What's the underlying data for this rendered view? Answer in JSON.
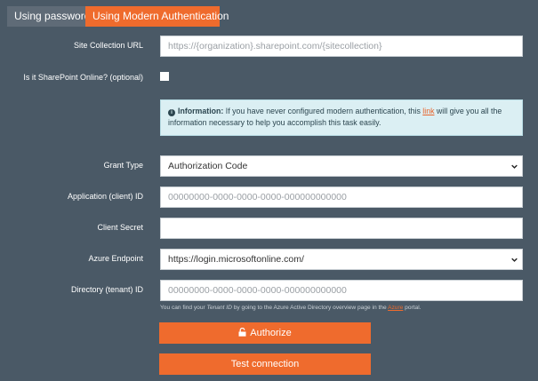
{
  "tabs": [
    {
      "label": "Using password",
      "active": false
    },
    {
      "label": "Using Modern Authentication",
      "active": true
    }
  ],
  "form": {
    "site_url": {
      "label": "Site Collection URL",
      "placeholder": "https://{organization}.sharepoint.com/{sitecollection}"
    },
    "sharepoint_online": {
      "label": "Is it SharePoint Online? (optional)",
      "checked": false
    },
    "info": {
      "title": "Information:",
      "text_before": " If you have never configured modern authentication, this ",
      "link": "link",
      "text_after": " will give you all the information necessary to help you accomplish this task easily."
    },
    "grant_type": {
      "label": "Grant Type",
      "value": "Authorization Code"
    },
    "client_id": {
      "label": "Application (client) ID",
      "placeholder": "00000000-0000-0000-0000-000000000000"
    },
    "client_secret": {
      "label": "Client Secret",
      "value": ""
    },
    "azure_endpoint": {
      "label": "Azure Endpoint",
      "value": "https://login.microsoftonline.com/"
    },
    "tenant_id": {
      "label": "Directory (tenant) ID",
      "placeholder": "00000000-0000-0000-0000-000000000000",
      "hint_before": "You can find your ",
      "hint_em": "Tenant ID",
      "hint_middle": " by going to the Azure Active Directory overview page in the ",
      "hint_link": "Azure",
      "hint_after": " portal."
    }
  },
  "buttons": {
    "authorize": "Authorize",
    "test": "Test connection"
  },
  "colors": {
    "background": "#4a5966",
    "accent": "#ef6b2d",
    "info_bg": "#dbeff3"
  }
}
